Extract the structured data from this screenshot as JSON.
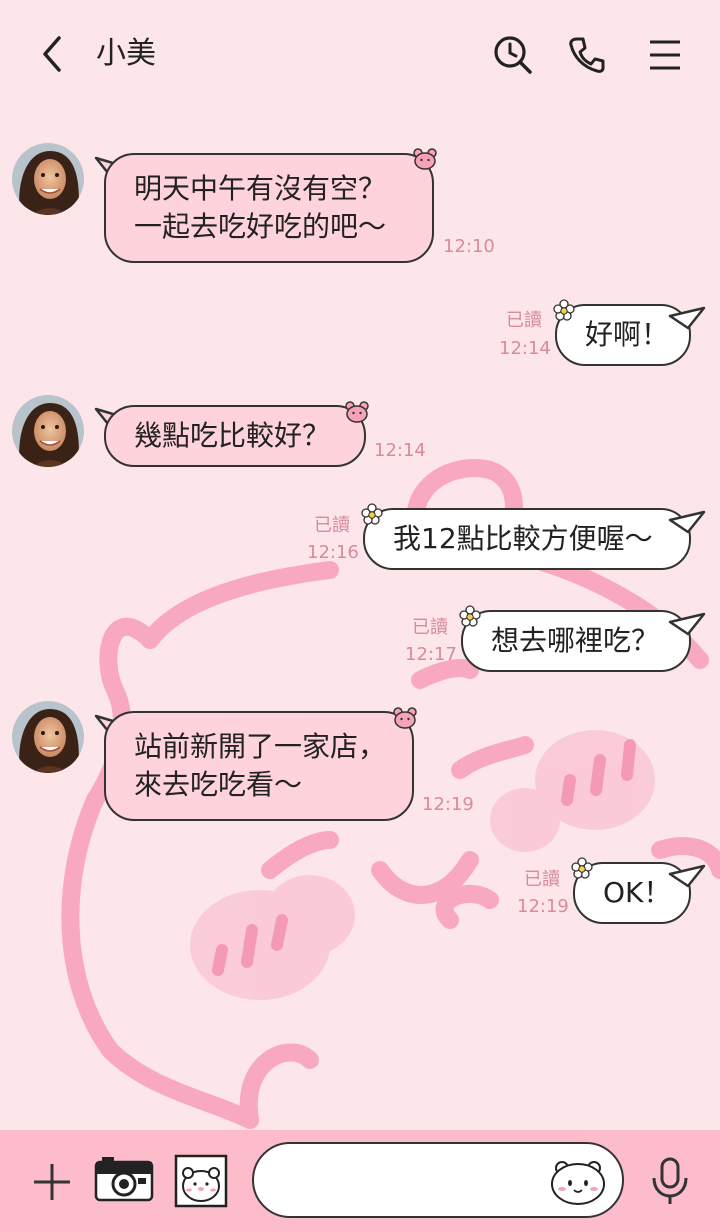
{
  "header": {
    "contact_name": "小美",
    "icons": [
      "back-chevron-icon",
      "search-history-icon",
      "phone-icon",
      "menu-icon"
    ]
  },
  "messages": [
    {
      "side": "in",
      "lines": [
        "明天中午有沒有空？",
        "一起去吃好吃的吧～"
      ],
      "time": "12:10"
    },
    {
      "side": "out",
      "lines": [
        "好啊！"
      ],
      "time": "12:14",
      "read": "已讀"
    },
    {
      "side": "in",
      "lines": [
        "幾點吃比較好？"
      ],
      "time": "12:14"
    },
    {
      "side": "out",
      "lines": [
        "我12點比較方便喔～"
      ],
      "time": "12:16",
      "read": "已讀"
    },
    {
      "side": "out",
      "lines": [
        "想去哪裡吃？"
      ],
      "time": "12:17",
      "read": "已讀"
    },
    {
      "side": "in",
      "lines": [
        "站前新開了一家店，",
        "來去吃吃看～"
      ],
      "time": "12:19"
    },
    {
      "side": "out",
      "lines": [
        "OK！"
      ],
      "time": "12:19",
      "read": "已讀"
    }
  ],
  "bottom_bar": {
    "icons": [
      "plus-icon",
      "camera-icon",
      "image-icon",
      "emoji-icon",
      "microphone-icon"
    ],
    "input_value": ""
  },
  "colors": {
    "background": "#fde6ea",
    "incoming_bubble": "#ffd3dc",
    "outgoing_bubble": "#ffffff",
    "bottom_bar": "#fcbccb",
    "meta_text": "#d98a9b"
  }
}
